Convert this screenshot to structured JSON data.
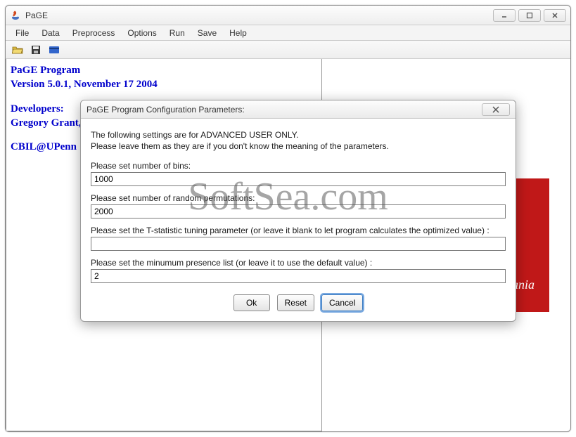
{
  "window": {
    "title": "PaGE",
    "controls": {
      "minimize": "_",
      "maximize": "□",
      "close": "X"
    }
  },
  "menu": {
    "file": "File",
    "data": "Data",
    "preprocess": "Preprocess",
    "options": "Options",
    "run": "Run",
    "save": "Save",
    "help": "Help"
  },
  "toolbar": {
    "open": "open-icon",
    "save": "save-icon",
    "card": "card-icon"
  },
  "info": {
    "program_name": "PaGE Program",
    "version_line": "Version 5.0.1, November 17 2004",
    "developers_label": "Developers:",
    "developer_1": "Gregory Grant,",
    "affiliation": "CBIL@UPenn"
  },
  "red_block": {
    "visible_text": "ylvania"
  },
  "watermark": "SoftSea.com",
  "dialog": {
    "title": "PaGE Program Configuration Parameters:",
    "notice_line1": "The following settings are for ADVANCED USER ONLY.",
    "notice_line2": "Please leave them as they are if you don't know the meaning of the parameters.",
    "fields": {
      "bins_label": "Please set number of bins:",
      "bins_value": "1000",
      "perm_label": "Please set number of random permutations:",
      "perm_value": "2000",
      "tstat_label": "Please set the T-statistic tuning parameter (or leave it blank to let program calculates the optimized value) :",
      "tstat_value": "",
      "presence_label": "Please set the minumum presence list (or leave it to use the default value) :",
      "presence_value": "2"
    },
    "buttons": {
      "ok": "Ok",
      "reset": "Reset",
      "cancel": "Cancel"
    }
  }
}
